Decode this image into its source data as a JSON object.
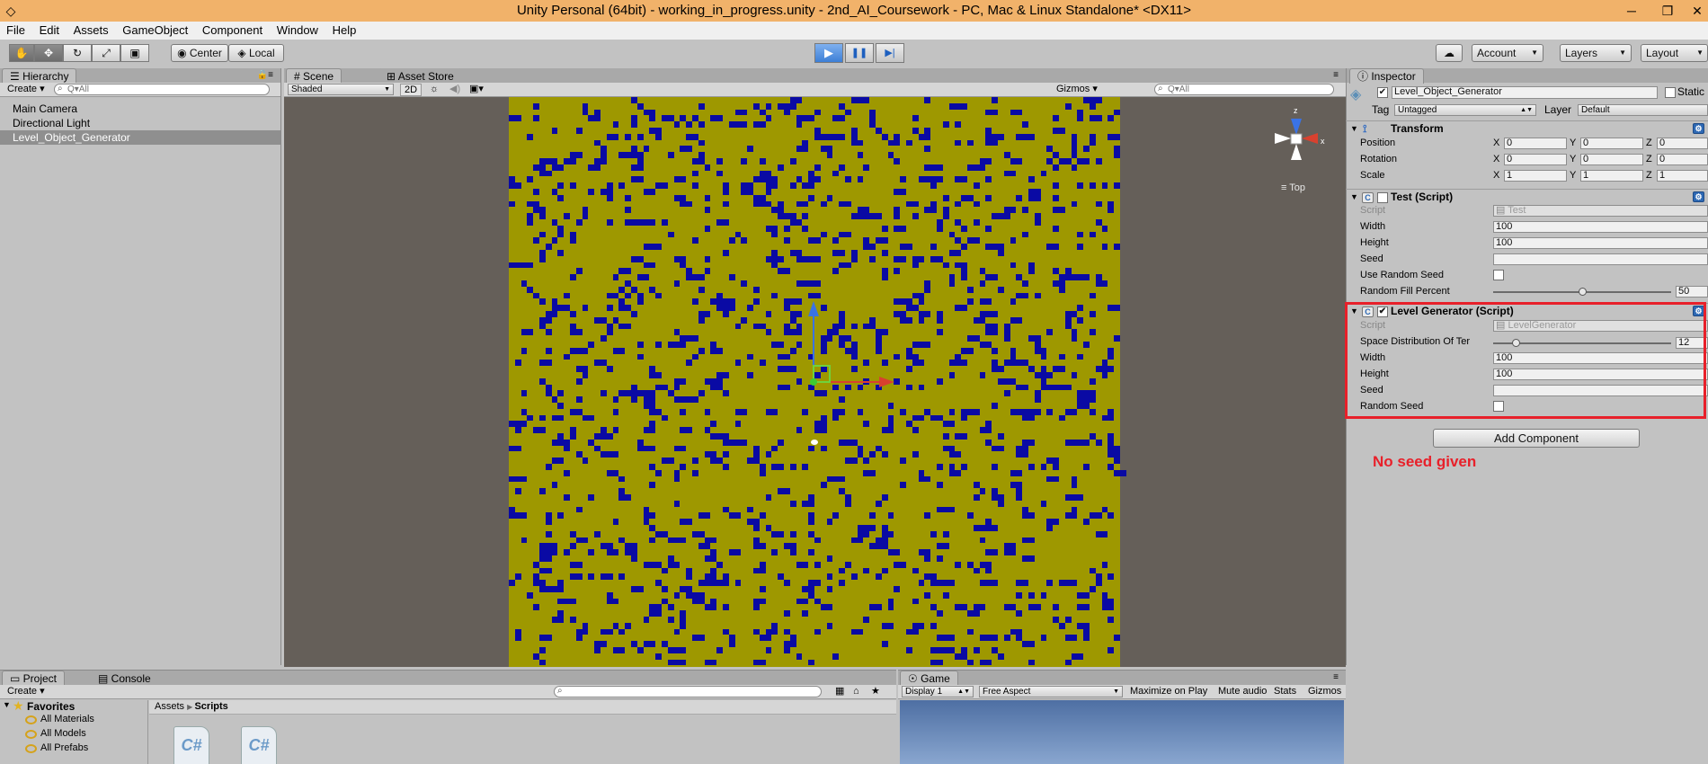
{
  "window": {
    "title": "Unity Personal (64bit) - working_in_progress.unity - 2nd_AI_Coursework - PC, Mac & Linux Standalone* <DX11>",
    "minimize": "─",
    "restore": "❐",
    "close": "✕"
  },
  "menu": [
    "File",
    "Edit",
    "Assets",
    "GameObject",
    "Component",
    "Window",
    "Help"
  ],
  "toolbar": {
    "tools": [
      "hand-icon",
      "move-icon",
      "rotate-icon",
      "scale-icon",
      "rect-icon"
    ],
    "pivot_label": "Center",
    "space_label": "Local",
    "play": "▶",
    "pause": "❚❚",
    "step": "▶|",
    "account_label": "Account",
    "layers_label": "Layers",
    "layout_label": "Layout"
  },
  "hierarchy": {
    "tab": "Hierarchy",
    "create": "Create",
    "search_placeholder": "Q▾All",
    "items": [
      "Main Camera",
      "Directional Light",
      "Level_Object_Generator"
    ]
  },
  "scene": {
    "tab_scene": "Scene",
    "tab_store": "Asset Store",
    "shading": "Shaded",
    "mode_2d": "2D",
    "gizmos": "Gizmos",
    "search_placeholder": "Q▾All",
    "gizmo_view": "≡ Top",
    "axis_z": "z",
    "axis_x": "x"
  },
  "inspector": {
    "tab": "Inspector",
    "static_label": "Static",
    "object_name": "Level_Object_Generator",
    "tag_label": "Tag",
    "tag_value": "Untagged",
    "layer_label": "Layer",
    "layer_value": "Default",
    "transform": {
      "title": "Transform",
      "rows": [
        {
          "label": "Position",
          "x": "0",
          "y": "0",
          "z": "0"
        },
        {
          "label": "Rotation",
          "x": "0",
          "y": "0",
          "z": "0"
        },
        {
          "label": "Scale",
          "x": "1",
          "y": "1",
          "z": "1"
        }
      ]
    },
    "test_script": {
      "title": "Test (Script)",
      "script_label": "Script",
      "script_value": "Test",
      "width_label": "Width",
      "width_value": "100",
      "height_label": "Height",
      "height_value": "100",
      "seed_label": "Seed",
      "seed_value": "",
      "use_random_seed_label": "Use Random Seed",
      "use_random_seed": false,
      "fill_label": "Random Fill Percent",
      "fill_value": "50"
    },
    "level_generator": {
      "title": "Level Generator (Script)",
      "script_label": "Script",
      "script_value": "LevelGenerator",
      "space_label": "Space Distribution Of Ter",
      "space_value": "12",
      "width_label": "Width",
      "width_value": "100",
      "height_label": "Height",
      "height_value": "100",
      "seed_label": "Seed",
      "seed_value": "",
      "random_seed_label": "Random Seed",
      "random_seed": false
    },
    "add_component": "Add Component",
    "annotation": "No seed given",
    "annotation_color": "#e8202a"
  },
  "project": {
    "tab_project": "Project",
    "tab_console": "Console",
    "create": "Create",
    "favorites_label": "Favorites",
    "favorites": [
      "All Materials",
      "All Models",
      "All Prefabs"
    ],
    "breadcrumb_root": "Assets",
    "breadcrumb_current": "Scripts",
    "file_icon_label": "C#"
  },
  "game": {
    "tab": "Game",
    "display": "Display 1",
    "aspect": "Free Aspect",
    "maximize": "Maximize on Play",
    "mute": "Mute audio",
    "stats": "Stats",
    "gizmos": "Gizmos"
  },
  "colors": {
    "title_bar": "#f1b26a",
    "grid_floor": "#9e9800",
    "grid_wall": "#0a0aa4",
    "highlight_box": "#e8202a"
  }
}
